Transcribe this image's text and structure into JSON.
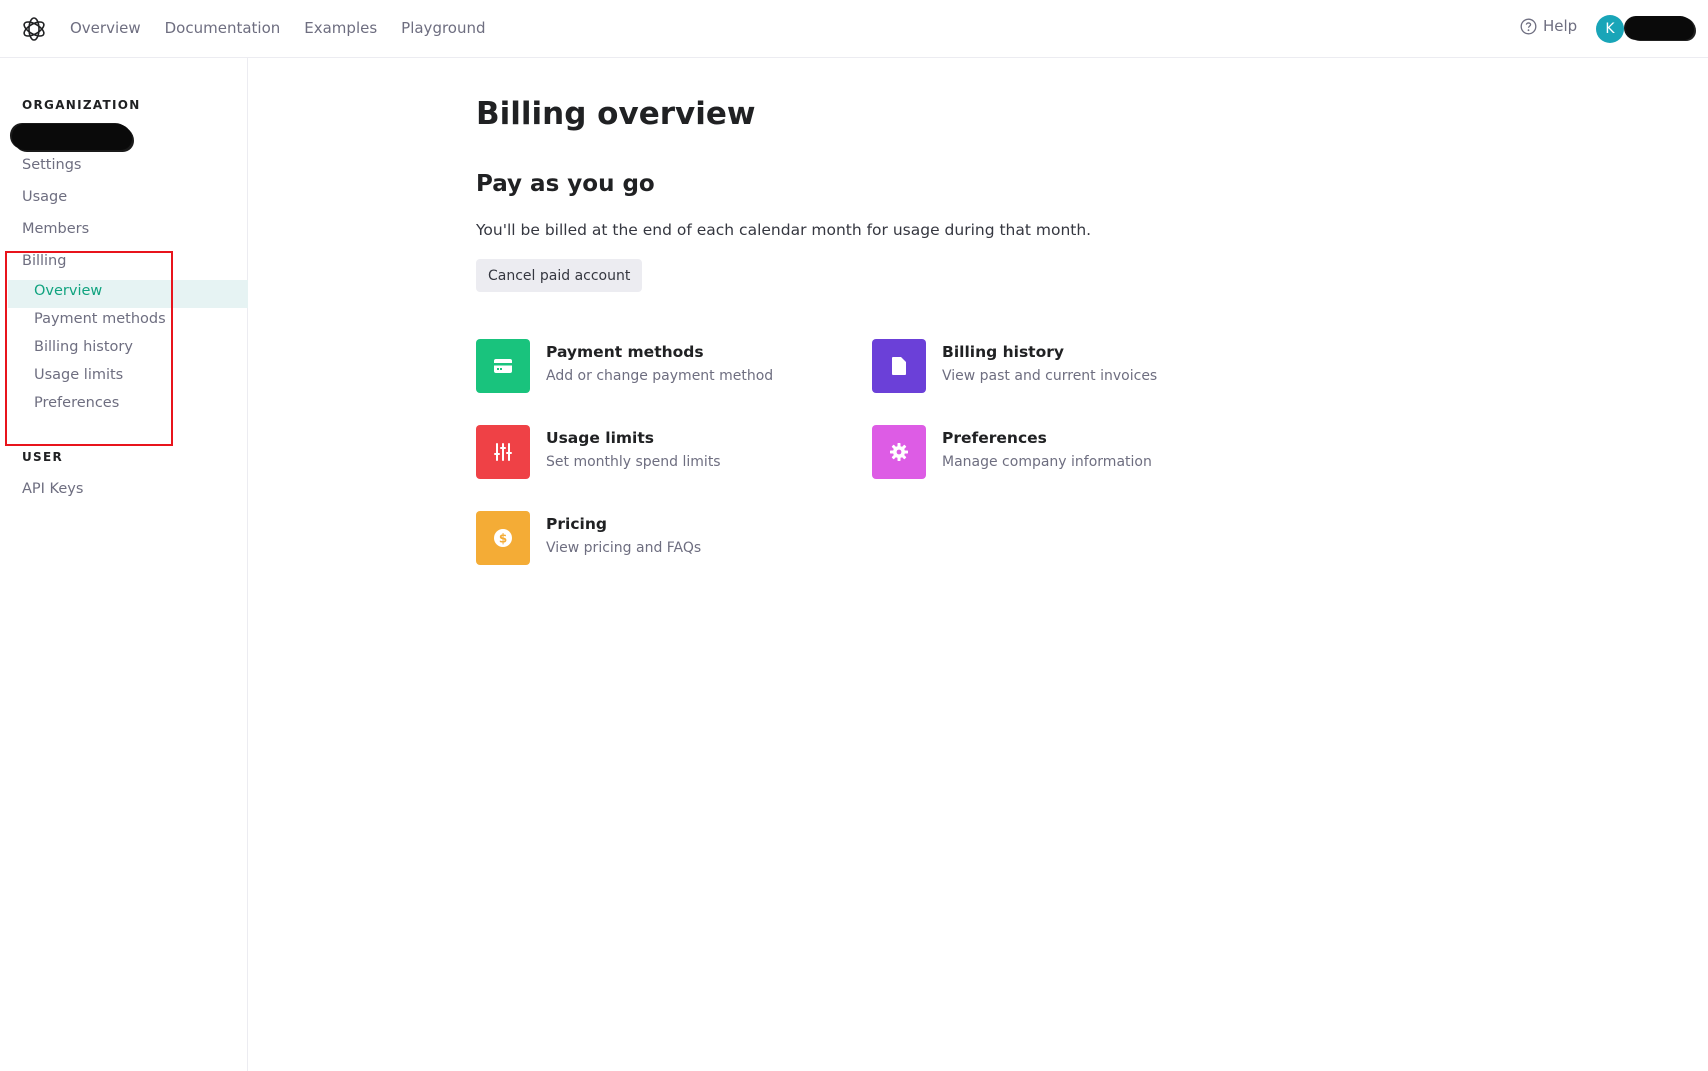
{
  "topbar": {
    "nav": [
      "Overview",
      "Documentation",
      "Examples",
      "Playground"
    ],
    "help_label": "Help",
    "avatar_initial": "K"
  },
  "sidebar": {
    "org_title": "ORGANIZATION",
    "org_items": [
      "Settings",
      "Usage",
      "Members",
      "Billing"
    ],
    "billing_subitems": [
      "Overview",
      "Payment methods",
      "Billing history",
      "Usage limits",
      "Preferences"
    ],
    "active_subitem": "Overview",
    "user_title": "USER",
    "user_items": [
      "API Keys"
    ]
  },
  "main": {
    "title": "Billing overview",
    "plan_title": "Pay as you go",
    "plan_desc": "You'll be billed at the end of each calendar month for usage during that month.",
    "cancel_label": "Cancel paid account",
    "cards": [
      {
        "title": "Payment methods",
        "desc": "Add or change payment method",
        "icon": "credit-card-icon",
        "color": "#19c37d"
      },
      {
        "title": "Billing history",
        "desc": "View past and current invoices",
        "icon": "document-icon",
        "color": "#6b40d8"
      },
      {
        "title": "Usage limits",
        "desc": "Set monthly spend limits",
        "icon": "sliders-icon",
        "color": "#ef4146"
      },
      {
        "title": "Preferences",
        "desc": "Manage company information",
        "icon": "gear-icon",
        "color": "#dd5ce5"
      },
      {
        "title": "Pricing",
        "desc": "View pricing and FAQs",
        "icon": "dollar-icon",
        "color": "#f4ac36"
      }
    ]
  },
  "colors": {
    "accent": "#10a37f",
    "active_bg": "#e6f3f3",
    "highlight_box": "#e8141c"
  }
}
